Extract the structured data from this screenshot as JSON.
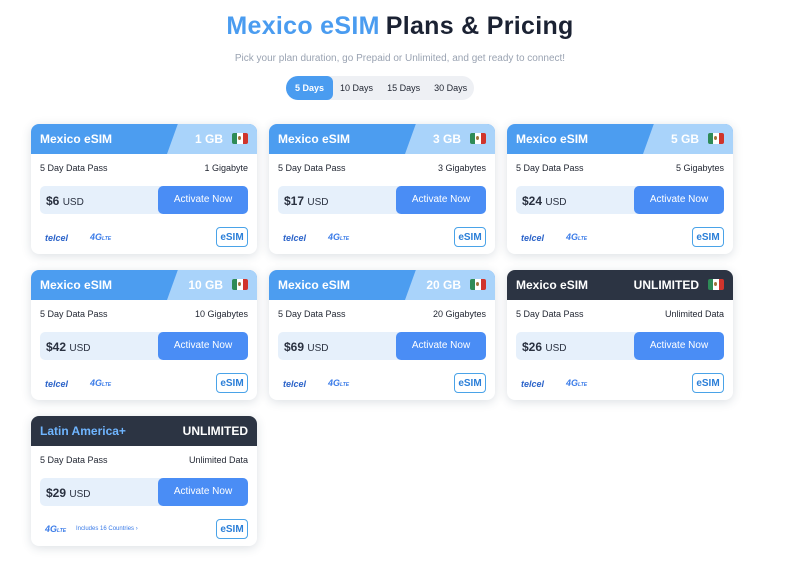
{
  "header": {
    "title_part1": "Mexico eSIM",
    "title_part2": "Plans & Pricing",
    "subtitle": "Pick your plan duration, go Prepaid or Unlimited, and get ready to connect!"
  },
  "tabs": [
    {
      "label": "5 Days",
      "active": true
    },
    {
      "label": "10 Days",
      "active": false
    },
    {
      "label": "15 Days",
      "active": false
    },
    {
      "label": "30 Days",
      "active": false
    }
  ],
  "cards": [
    {
      "name": "Mexico eSIM",
      "size": "1 GB",
      "pass": "5 Day Data Pass",
      "data": "1 Gigabyte",
      "price": "$6",
      "currency": "USD",
      "button": "Activate Now",
      "carrier": "telcel",
      "network": "4G",
      "network_sub": "LTE",
      "badge": "eSIM"
    },
    {
      "name": "Mexico eSIM",
      "size": "3 GB",
      "pass": "5 Day Data Pass",
      "data": "3 Gigabytes",
      "price": "$17",
      "currency": "USD",
      "button": "Activate Now",
      "carrier": "telcel",
      "network": "4G",
      "network_sub": "LTE",
      "badge": "eSIM"
    },
    {
      "name": "Mexico eSIM",
      "size": "5 GB",
      "pass": "5 Day Data Pass",
      "data": "5 Gigabytes",
      "price": "$24",
      "currency": "USD",
      "button": "Activate Now",
      "carrier": "telcel",
      "network": "4G",
      "network_sub": "LTE",
      "badge": "eSIM"
    },
    {
      "name": "Mexico eSIM",
      "size": "10 GB",
      "pass": "5 Day Data Pass",
      "data": "10 Gigabytes",
      "price": "$42",
      "currency": "USD",
      "button": "Activate Now",
      "carrier": "telcel",
      "network": "4G",
      "network_sub": "LTE",
      "badge": "eSIM"
    },
    {
      "name": "Mexico eSIM",
      "size": "20 GB",
      "pass": "5 Day Data Pass",
      "data": "20 Gigabytes",
      "price": "$69",
      "currency": "USD",
      "button": "Activate Now",
      "carrier": "telcel",
      "network": "4G",
      "network_sub": "LTE",
      "badge": "eSIM"
    },
    {
      "name": "Mexico eSIM",
      "size": "UNLIMITED",
      "pass": "5 Day Data Pass",
      "data": "Unlimited Data",
      "price": "$26",
      "currency": "USD",
      "button": "Activate Now",
      "carrier": "telcel",
      "network": "4G",
      "network_sub": "LTE",
      "badge": "eSIM"
    },
    {
      "name": "Latin America+",
      "size": "UNLIMITED",
      "pass": "5 Day Data Pass",
      "data": "Unlimited Data",
      "price": "$29",
      "currency": "USD",
      "button": "Activate Now",
      "network": "4G",
      "network_sub": "LTE",
      "countries": "Includes 16 Countries ›",
      "badge": "eSIM"
    }
  ],
  "colors": {
    "accent": "#4a9cf0",
    "button": "#4a8df5",
    "dark_header": "#2c3443"
  }
}
